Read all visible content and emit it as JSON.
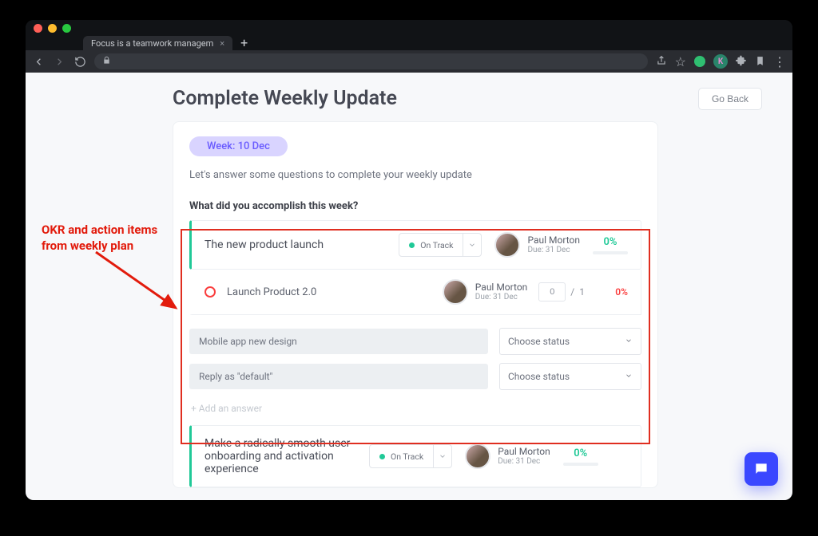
{
  "browser": {
    "tab_title": "Focus is a teamwork managem"
  },
  "header": {
    "title": "Complete Weekly Update",
    "go_back": "Go Back"
  },
  "week_pill": "Week: 10 Dec",
  "intro": "Let's answer some questions to complete your weekly update",
  "question": "What did you accomplish this week?",
  "okr1": {
    "title": "The new product launch",
    "status": "On Track",
    "assignee": "Paul Morton",
    "due": "Due: 31 Dec",
    "percent": "0%",
    "sub": {
      "title": "Launch Product 2.0",
      "assignee": "Paul Morton",
      "due": "Due: 31 Dec",
      "num": "0",
      "den": "1",
      "sep": "/",
      "percent": "0%"
    }
  },
  "answers": [
    {
      "text": "Mobile app new design",
      "status_placeholder": "Choose status"
    },
    {
      "text": "Reply as \"default\"",
      "status_placeholder": "Choose status"
    }
  ],
  "add_answer": "+ Add an answer",
  "okr2": {
    "title": "Make a radically smooth user onboarding and activation experience",
    "status": "On Track",
    "assignee": "Paul Morton",
    "due": "Due: 31 Dec",
    "percent": "0%"
  },
  "annotation": {
    "line1": "OKR and action items",
    "line2": "from weekly plan"
  },
  "ext_letter": "K"
}
